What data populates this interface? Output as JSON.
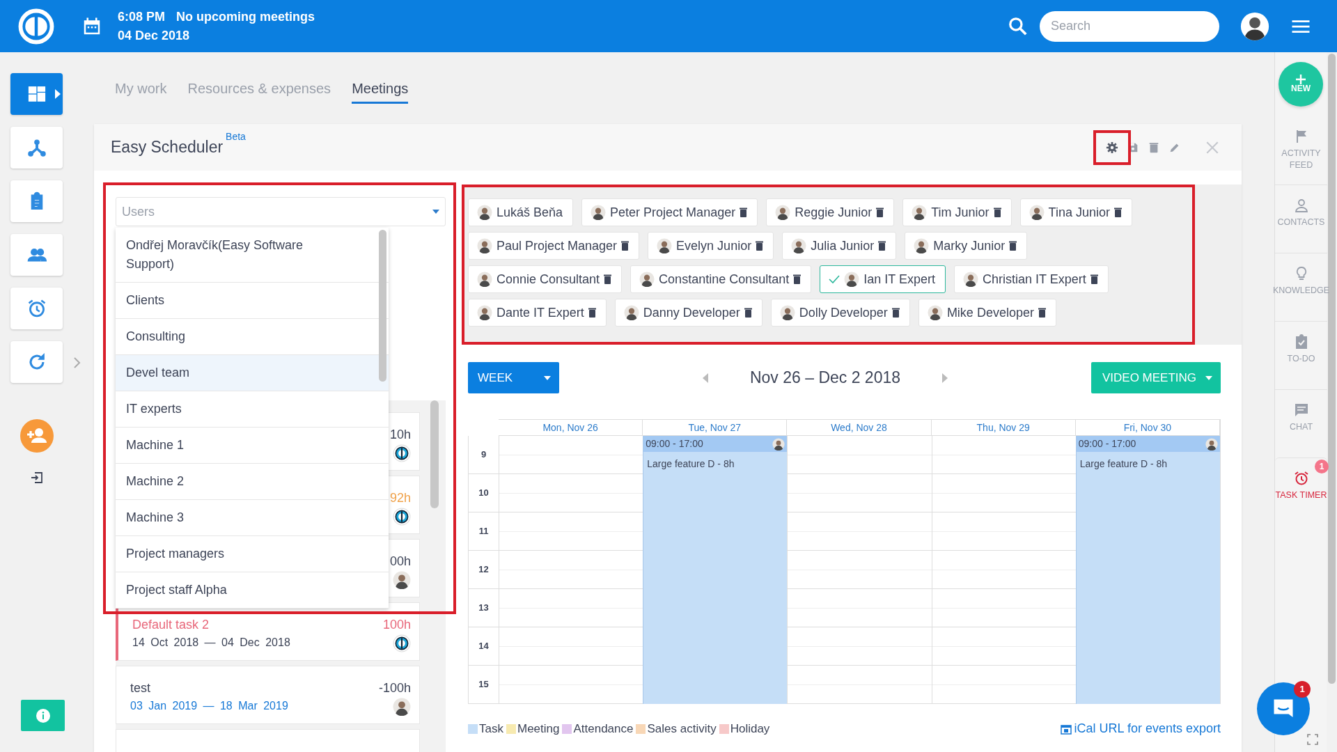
{
  "topbar": {
    "time": "6:08 PM",
    "meetings": "No upcoming meetings",
    "date": "04 Dec 2018",
    "search": {
      "placeholder": "Search"
    }
  },
  "left_nav": [
    {
      "kind": "dashboard",
      "selected": true
    },
    {
      "kind": "hierarchy",
      "selected": false
    },
    {
      "kind": "clipboard",
      "selected": false
    },
    {
      "kind": "people",
      "selected": false
    },
    {
      "kind": "alarm",
      "selected": false
    },
    {
      "kind": "refresh",
      "selected": false
    }
  ],
  "tabs": [
    {
      "label": "My work",
      "selected": false
    },
    {
      "label": "Resources & expenses",
      "selected": false
    },
    {
      "label": "Meetings",
      "selected": true
    }
  ],
  "scheduler": {
    "title": "Easy Scheduler",
    "badge": "Beta",
    "settings_highlighted": true
  },
  "user_select": {
    "placeholder": "Users",
    "highlighted": true,
    "options": [
      {
        "label": "Ondřej Moravčík(Easy Software Support)",
        "selected": false
      },
      {
        "label": "Clients",
        "selected": false
      },
      {
        "label": "Consulting",
        "selected": false
      },
      {
        "label": "Devel team",
        "selected": true
      },
      {
        "label": "IT experts",
        "selected": false
      },
      {
        "label": "Machine 1",
        "selected": false
      },
      {
        "label": "Machine 2",
        "selected": false
      },
      {
        "label": "Machine 3",
        "selected": false
      },
      {
        "label": "Project managers",
        "selected": false
      },
      {
        "label": "Project staff Alpha",
        "selected": false
      }
    ]
  },
  "task_cards": [
    {
      "hours": "10h",
      "color": "#3d4457",
      "kind": "company"
    },
    {
      "hours": "92h",
      "color": "#f0a24a",
      "kind": "company"
    },
    {
      "hours": "00h",
      "color": "#3d4457",
      "kind": "person"
    },
    {
      "title": "Default task 2",
      "hours": "100h",
      "dates": "14 Oct 2018 — 04 Dec 2018",
      "color": "#e8677a",
      "flagged": true,
      "upcoming": false,
      "kind": "company"
    },
    {
      "title": "test",
      "hours": "-100h",
      "dates": "03 Jan 2019 — 18 Mar 2019",
      "color": "#3d4457",
      "flagged": false,
      "upcoming": true,
      "kind": "person"
    }
  ],
  "users_highlighted": true,
  "users": [
    {
      "name": "Lukáš Beňa",
      "selected": false,
      "removable": false
    },
    {
      "name": "Peter Project Manager",
      "selected": false,
      "removable": true
    },
    {
      "name": "Reggie Junior",
      "selected": false,
      "removable": true
    },
    {
      "name": "Tim Junior",
      "selected": false,
      "removable": true
    },
    {
      "name": "Tina Junior",
      "selected": false,
      "removable": true
    },
    {
      "name": "Paul Project Manager",
      "selected": false,
      "removable": true
    },
    {
      "name": "Evelyn Junior",
      "selected": false,
      "removable": true
    },
    {
      "name": "Julia Junior",
      "selected": false,
      "removable": true
    },
    {
      "name": "Marky Junior",
      "selected": false,
      "removable": true
    },
    {
      "name": "Connie Consultant",
      "selected": false,
      "removable": true
    },
    {
      "name": "Constantine Consultant",
      "selected": false,
      "removable": true
    },
    {
      "name": "Ian IT Expert",
      "selected": true,
      "removable": false
    },
    {
      "name": "Christian IT Expert",
      "selected": false,
      "removable": true
    },
    {
      "name": "Dante IT Expert",
      "selected": false,
      "removable": true
    },
    {
      "name": "Danny Developer",
      "selected": false,
      "removable": true
    },
    {
      "name": "Dolly Developer",
      "selected": false,
      "removable": true
    },
    {
      "name": "Mike Developer",
      "selected": false,
      "removable": true
    }
  ],
  "calendar": {
    "view": "WEEK",
    "range": "Nov 26 – Dec 2 2018",
    "action": "VIDEO MEETING",
    "days": [
      {
        "label": "Mon, Nov 26"
      },
      {
        "label": "Tue, Nov 27",
        "events": [
          {
            "time": "09:00 - 17:00",
            "title": "Large feature D - 8h"
          }
        ]
      },
      {
        "label": "Wed, Nov 28"
      },
      {
        "label": "Thu, Nov 29"
      },
      {
        "label": "Fri, Nov 30",
        "events": [
          {
            "time": "09:00 - 17:00",
            "title": "Large feature D - 8h"
          }
        ]
      }
    ],
    "hours": [
      "9",
      "10",
      "11",
      "12",
      "13",
      "14",
      "15"
    ],
    "legend": [
      {
        "label": "Task",
        "color": "#c5def7"
      },
      {
        "label": "Meeting",
        "color": "#f7eab0"
      },
      {
        "label": "Attendance",
        "color": "#e2c6ef"
      },
      {
        "label": "Sales activity",
        "color": "#f8d7b6"
      },
      {
        "label": "Holiday",
        "color": "#f7c9c9"
      }
    ],
    "ical_link": "iCal URL for events export"
  },
  "right_nav": {
    "new_label": "NEW",
    "items": [
      {
        "kind": "flag",
        "label": "ACTIVITY FEED",
        "alert": false
      },
      {
        "kind": "person",
        "label": "CONTACTS",
        "alert": false
      },
      {
        "kind": "bulb",
        "label": "KNOWLEDGE",
        "alert": false
      },
      {
        "kind": "todo",
        "label": "TO-DO",
        "alert": false
      },
      {
        "kind": "chat",
        "label": "CHAT",
        "alert": false
      },
      {
        "kind": "alarm",
        "label": "TASK TIMER",
        "alert": true,
        "badge": "1"
      }
    ]
  },
  "chat_widget": {
    "badge": "1"
  }
}
